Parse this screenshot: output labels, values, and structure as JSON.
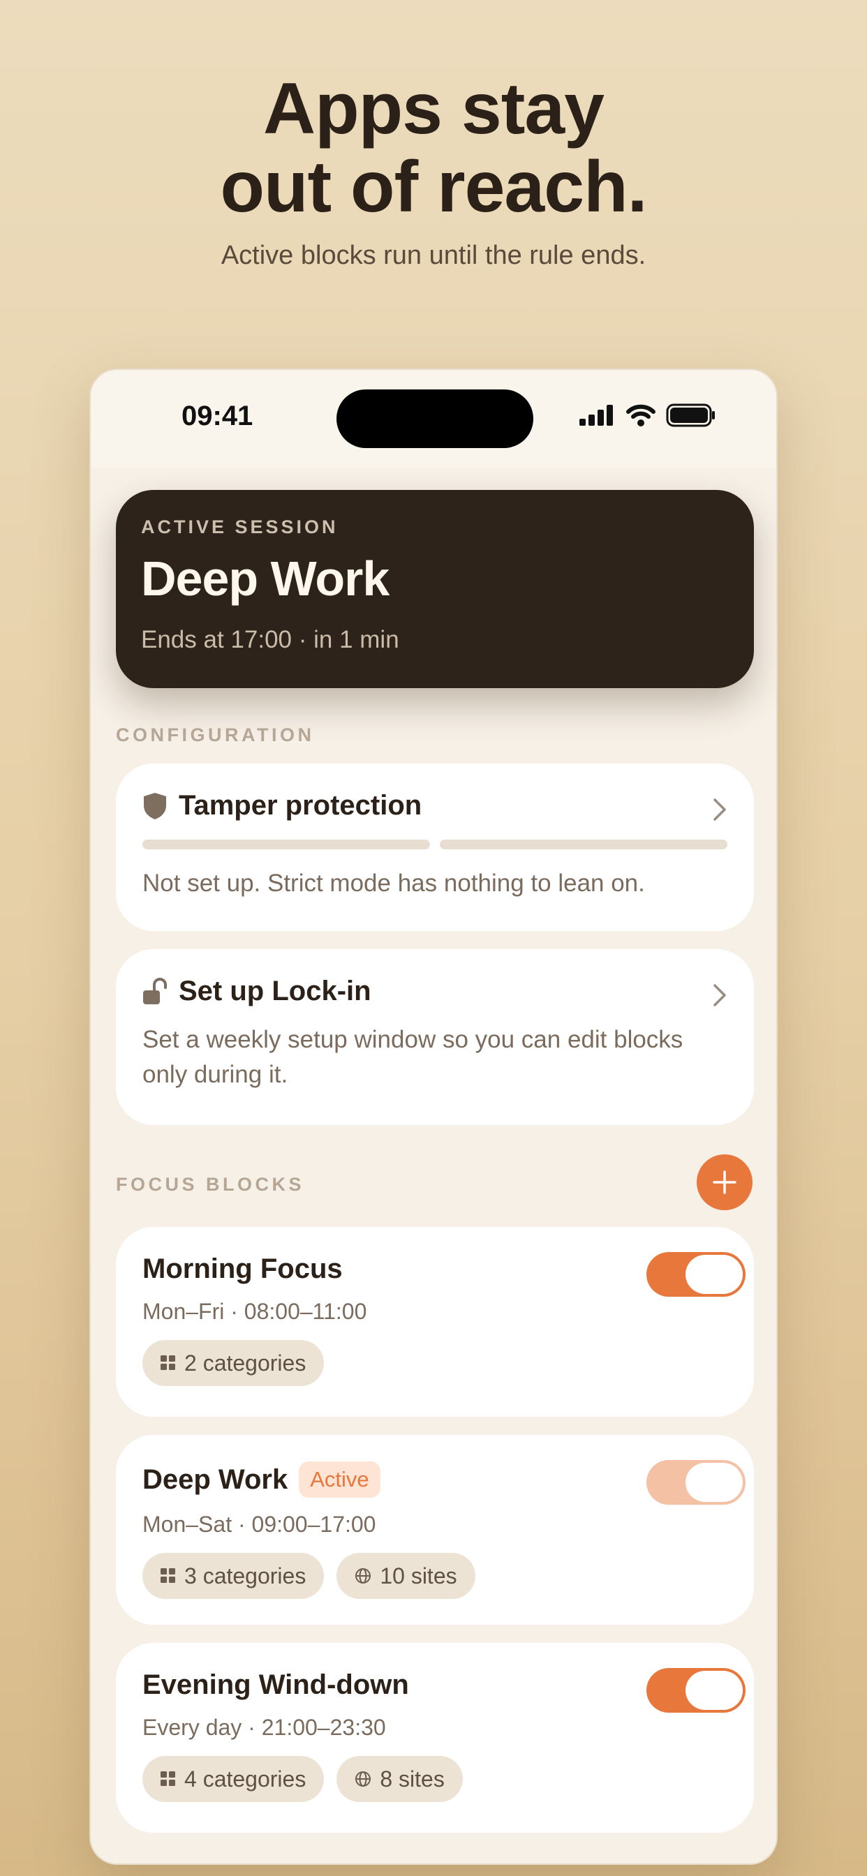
{
  "headline": {
    "line1": "Apps stay",
    "line2": "out of reach.",
    "subtitle": "Active blocks run until the rule ends."
  },
  "status_bar": {
    "time": "09:41",
    "icons": [
      "cellular-signal-icon",
      "wifi-icon",
      "battery-icon"
    ]
  },
  "active_session": {
    "eyebrow": "ACTIVE SESSION",
    "title": "Deep Work",
    "subtitle": "Ends at 17:00 · in 1 min"
  },
  "configuration": {
    "label": "CONFIGURATION",
    "tamper": {
      "icon": "shield-icon",
      "title": "Tamper protection",
      "progress_segments_filled": 0,
      "progress_segments_total": 2,
      "description": "Not set up. Strict mode has nothing to lean on."
    },
    "lockin": {
      "icon": "unlocked-padlock-icon",
      "title": "Set up Lock-in",
      "description": "Set a weekly setup window so you can edit blocks only during it."
    }
  },
  "focus_blocks": {
    "label": "FOCUS BLOCKS",
    "items": [
      {
        "name": "Morning Focus",
        "badge": "",
        "schedule": "Mon–Fri · 08:00–11:00",
        "categories": "2 categories",
        "sites": "",
        "enabled": true
      },
      {
        "name": "Deep Work",
        "badge": "Active",
        "schedule": "Mon–Sat · 09:00–17:00",
        "categories": "3 categories",
        "sites": "10 sites",
        "enabled": true
      },
      {
        "name": "Evening Wind-down",
        "badge": "",
        "schedule": "Every day · 21:00–23:30",
        "categories": "4 categories",
        "sites": "8 sites",
        "enabled": true
      }
    ]
  },
  "colors": {
    "accent": "#e8773b",
    "dark_card": "#2d231a",
    "background": "#ecdcbd",
    "phone_bg": "#f7f0e6"
  }
}
